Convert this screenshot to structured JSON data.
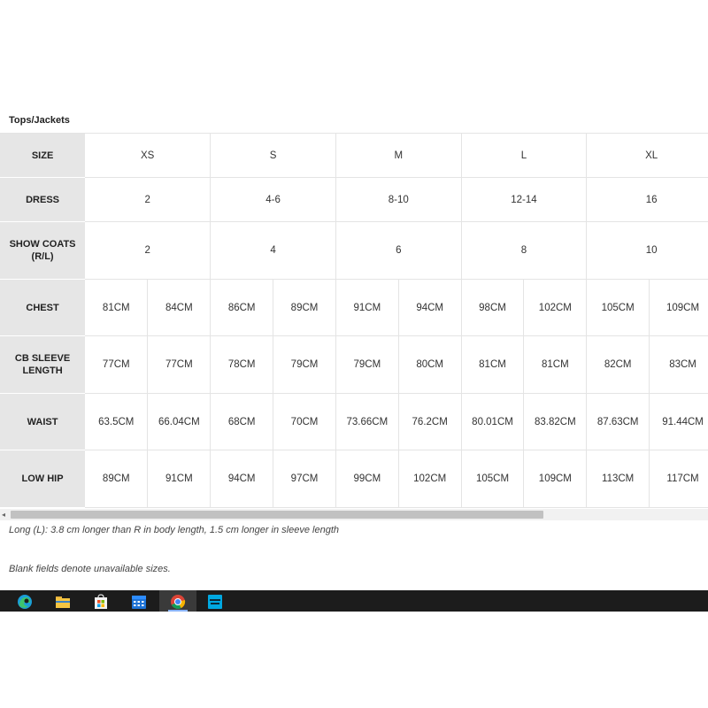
{
  "section_title": "Tops/Jackets",
  "table": {
    "rows": [
      {
        "label": "SIZE",
        "cells": [
          "XS",
          "S",
          "M",
          "L",
          "XL"
        ],
        "span": 2
      },
      {
        "label": "DRESS",
        "cells": [
          "2",
          "4-6",
          "8-10",
          "12-14",
          "16"
        ],
        "span": 2
      },
      {
        "label": "SHOW COATS (R/L)",
        "cells": [
          "2",
          "4",
          "6",
          "8",
          "10"
        ],
        "span": 2
      },
      {
        "label": "CHEST",
        "cells": [
          "81CM",
          "84CM",
          "86CM",
          "89CM",
          "91CM",
          "94CM",
          "98CM",
          "102CM",
          "105CM",
          "109CM"
        ],
        "span": 1
      },
      {
        "label": "CB SLEEVE LENGTH",
        "cells": [
          "77CM",
          "77CM",
          "78CM",
          "79CM",
          "79CM",
          "80CM",
          "81CM",
          "81CM",
          "82CM",
          "83CM"
        ],
        "span": 1
      },
      {
        "label": "WAIST",
        "cells": [
          "63.5CM",
          "66.04CM",
          "68CM",
          "70CM",
          "73.66CM",
          "76.2CM",
          "80.01CM",
          "83.82CM",
          "87.63CM",
          "91.44CM"
        ],
        "span": 1
      },
      {
        "label": "LOW HIP",
        "cells": [
          "89CM",
          "91CM",
          "94CM",
          "97CM",
          "99CM",
          "102CM",
          "105CM",
          "109CM",
          "113CM",
          "117CM"
        ],
        "span": 1
      }
    ]
  },
  "notes": {
    "long": "Long (L): 3.8 cm longer than R in body length, 1.5 cm longer in sleeve length",
    "blank": "Blank fields denote unavailable sizes."
  },
  "scrollbar": {
    "left_arrow": "◂"
  },
  "taskbar": {
    "icons": [
      "edge-icon",
      "file-explorer-icon",
      "microsoft-store-icon",
      "calendar-icon",
      "chrome-icon",
      "amazon-prime-video-icon"
    ],
    "active": "chrome-icon"
  },
  "colors": {
    "label_bg": "#e6e6e6",
    "taskbar_bg": "#1c1c1c",
    "scroll_thumb": "#c1c1c1"
  }
}
